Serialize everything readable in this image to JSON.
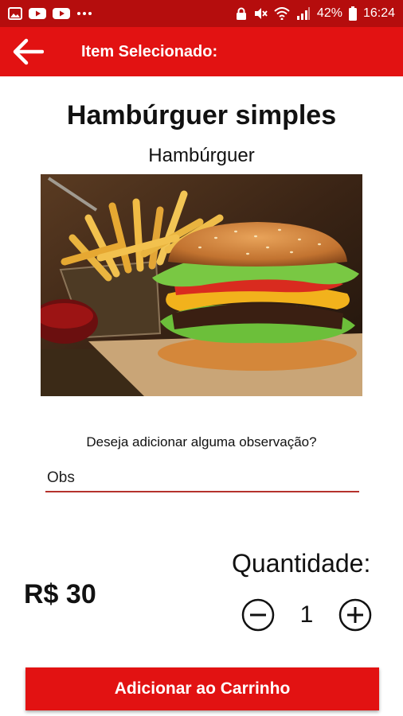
{
  "status_bar": {
    "battery_text": "42%",
    "time": "16:24",
    "left_icons": [
      "gallery-icon",
      "youtube-icon",
      "youtube-icon",
      "more-dots-icon"
    ],
    "right_icons": [
      "lock-icon",
      "mute-icon",
      "wifi-icon",
      "signal-icon",
      "battery-icon"
    ]
  },
  "app_bar": {
    "title": "Item Selecionado:",
    "back_icon": "arrow-back-icon",
    "color": "#e21212"
  },
  "item": {
    "name": "Hambúrguer simples",
    "category": "Hambúrguer",
    "image": "burger-and-fries-photo"
  },
  "observation": {
    "question": "Deseja adicionar alguma observação?",
    "placeholder": "Obs",
    "value": ""
  },
  "price": "R$ 30",
  "quantity": {
    "label": "Quantidade:",
    "value": "1",
    "decrease_icon": "minus-circle-icon",
    "increase_icon": "plus-circle-icon"
  },
  "add_to_cart_label": "Adicionar ao Carrinho",
  "colors": {
    "status_bar": "#b50d0d",
    "accent": "#e21212",
    "input_underline": "#b5322c"
  }
}
